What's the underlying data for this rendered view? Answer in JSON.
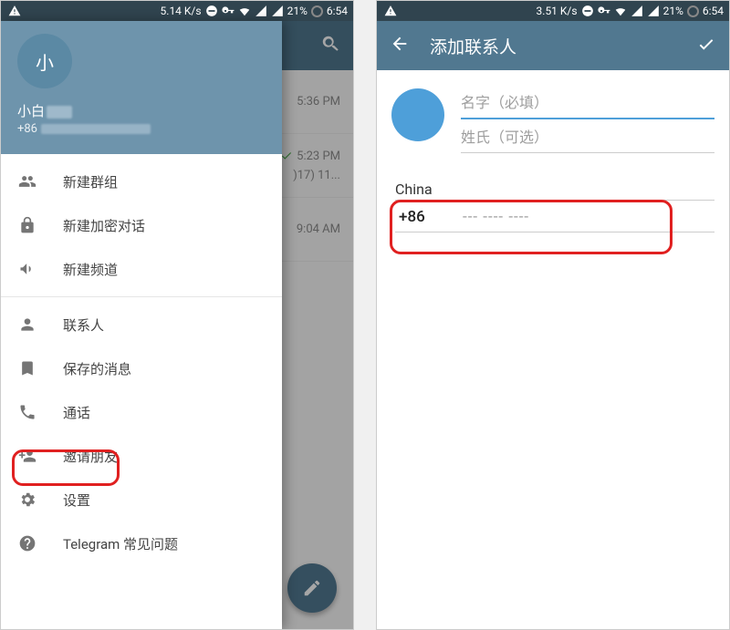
{
  "status_bar": {
    "left_speed": "5.14 K/s",
    "right_speed": "3.51 K/s",
    "battery_pct": "21%",
    "time": "6:54"
  },
  "left_screen": {
    "chat_rows": [
      {
        "time": "5:36 PM",
        "checked": false,
        "extra": ""
      },
      {
        "time": "5:23 PM",
        "checked": true,
        "extra": ")17) 11..."
      },
      {
        "time": "9:04 AM",
        "checked": false,
        "extra": ""
      }
    ],
    "drawer": {
      "avatar_text": "小",
      "user_name": "小白",
      "phone_prefix": "+86",
      "items": [
        {
          "icon": "group",
          "label": "新建群组"
        },
        {
          "icon": "lock",
          "label": "新建加密对话"
        },
        {
          "icon": "megaphone",
          "label": "新建频道"
        },
        {
          "icon": "person",
          "label": "联系人"
        },
        {
          "icon": "bookmark",
          "label": "保存的消息"
        },
        {
          "icon": "phone",
          "label": "通话"
        },
        {
          "icon": "invite",
          "label": "邀请朋友"
        },
        {
          "icon": "gear",
          "label": "设置"
        },
        {
          "icon": "help",
          "label": "Telegram 常见问题"
        }
      ]
    }
  },
  "right_screen": {
    "title": "添加联系人",
    "first_name_placeholder": "名字（必填）",
    "last_name_placeholder": "姓氏（可选）",
    "country": "China",
    "country_code": "+86",
    "phone_placeholder": "--- ---- ----"
  }
}
